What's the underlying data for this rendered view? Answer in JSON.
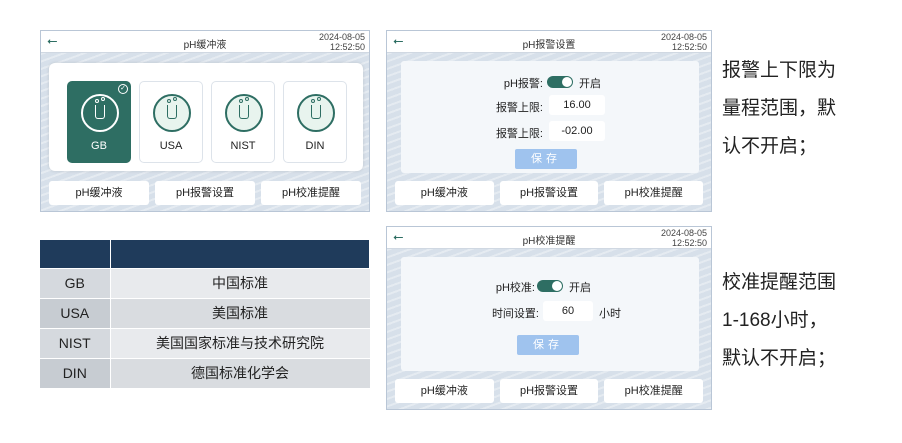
{
  "common": {
    "datetime_date": "2024-08-05",
    "datetime_time": "12:52:50",
    "usb_icon": "usb-icon",
    "tabs": [
      "pH缓冲液",
      "pH报警设置",
      "pH校准提醒"
    ]
  },
  "screen_buffer": {
    "title": "pH缓冲液",
    "standards": [
      {
        "label": "GB",
        "selected": true
      },
      {
        "label": "USA",
        "selected": false
      },
      {
        "label": "NIST",
        "selected": false
      },
      {
        "label": "DIN",
        "selected": false
      }
    ]
  },
  "screen_alarm": {
    "title": "pH报警设置",
    "alarm_label": "pH报警:",
    "alarm_state": "开启",
    "upper_label": "报警上限:",
    "upper_value": "16.00",
    "lower_label": "报警上限:",
    "lower_value": "-02.00",
    "save_label": "保存"
  },
  "screen_calibration": {
    "title": "pH校准提醒",
    "calib_label": "pH校准:",
    "calib_state": "开启",
    "time_label": "时间设置:",
    "time_value": "60",
    "time_unit": "小时",
    "save_label": "保存"
  },
  "notes": {
    "alarm_note": [
      "报警上下限为",
      "量程范围，默",
      "认不开启；"
    ],
    "calib_note": [
      "校准提醒范围",
      "1-168小时，",
      "默认不开启；"
    ]
  },
  "standards_table": {
    "headers": [
      "",
      ""
    ],
    "rows": [
      [
        "GB",
        "中国标准"
      ],
      [
        "USA",
        "美国标准"
      ],
      [
        "NIST",
        "美国国家标准与技术研究院"
      ],
      [
        "DIN",
        "德国标准化学会"
      ]
    ]
  }
}
